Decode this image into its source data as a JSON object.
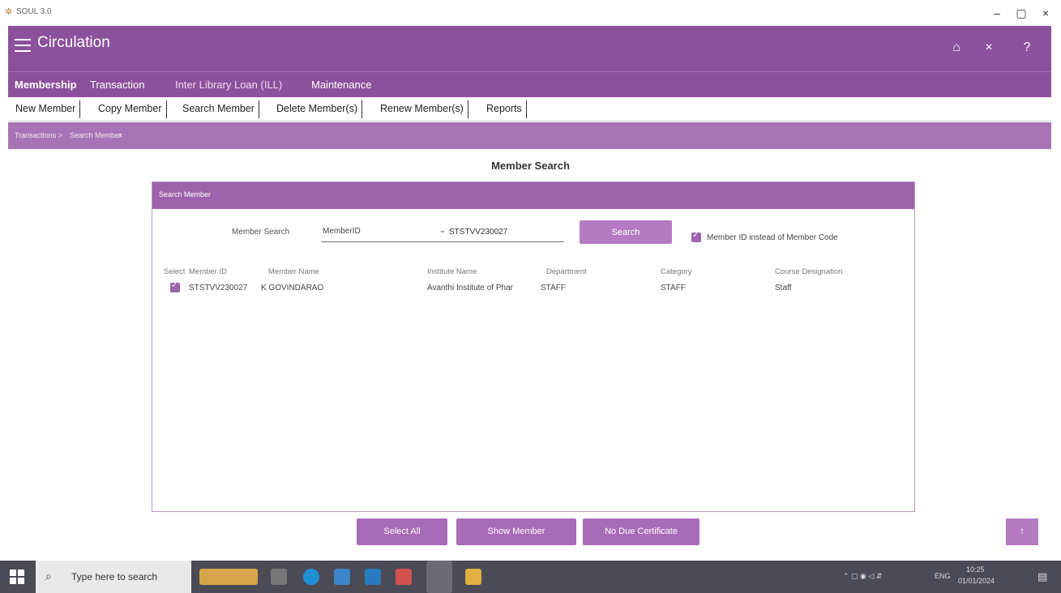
{
  "window": {
    "title": "SOUL 3.0",
    "controls": [
      "–",
      "▢",
      "×"
    ]
  },
  "header": {
    "title": "Circulation"
  },
  "modules": [
    "Membership",
    "Transaction",
    "Inter Library Loan (ILL)",
    "Maintenance"
  ],
  "tabs": [
    "New Member",
    "Copy Member",
    "Search Member",
    "Delete Member(s)",
    "Renew Member(s)",
    "Reports"
  ],
  "breadcrumb": {
    "item1": "Transactions >",
    "item2": "Search Member",
    "close": "×"
  },
  "page_title": "Member Search",
  "panel": {
    "title": "Search Member",
    "search_label": "Member Search",
    "search_by": "MemberID",
    "search_value": "STSTVV230027",
    "search_button": "Search",
    "checkbox_label": "Member ID instead of Member Code",
    "checkbox_checked": true
  },
  "table": {
    "headers": [
      "Select",
      "Member ID",
      "Member Name",
      "Institute Name",
      "Department",
      "Category",
      "Course Designation"
    ],
    "rows": [
      {
        "selected": true,
        "member_id": "STSTVV230027",
        "member_name": "K GOVINDARAO",
        "institute": "Avanthi Institute of Phar",
        "department": "STAFF",
        "category": "STAFF",
        "course": "Staff"
      }
    ]
  },
  "actions": {
    "select_all": "Select All",
    "show_member": "Show Member",
    "no_due": "No Due Certificate",
    "scroll_top": "↑"
  },
  "taskbar": {
    "search_placeholder": "Type here to search",
    "time": "10:25",
    "date": "01/01/2024",
    "lang": "ENG"
  },
  "colors": {
    "primary": "#8c519c",
    "breadcrumb": "#a773b6",
    "panel_head": "#9d63ad",
    "button": "#b57ac2"
  }
}
